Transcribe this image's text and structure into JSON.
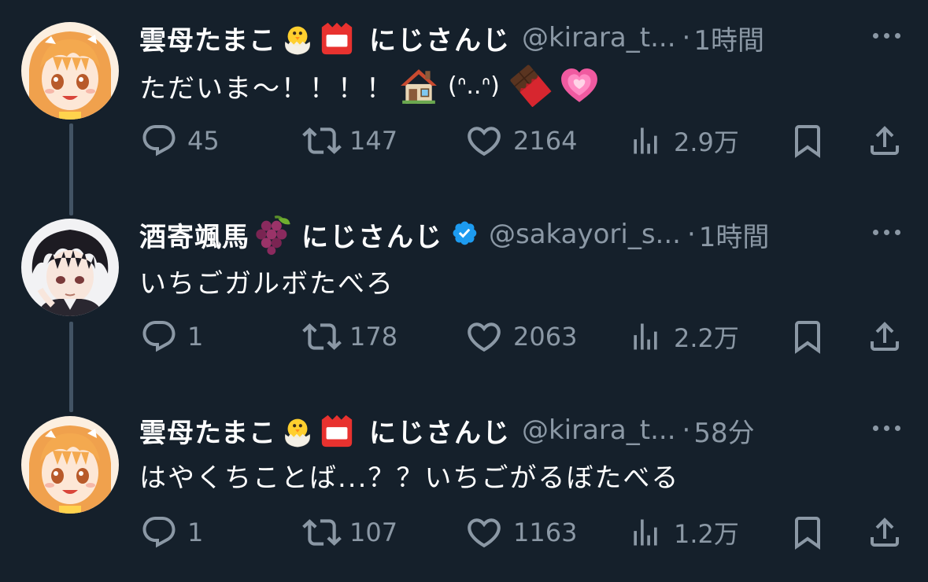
{
  "tweets": [
    {
      "display_name": "雲母たまこ",
      "org": "にじさんじ",
      "handle": "@kirara_t...",
      "separator": "·",
      "time": "1時間",
      "text": "ただいま〜！！！！",
      "emote": "(ᐢ..ᐢ)",
      "avatar_icon": "orange-hair-girl-avatar",
      "name_emojis": [
        "hatching-chick-icon",
        "name-badge-icon"
      ],
      "text_emojis": [
        "house-icon",
        "chocolate-bar-icon",
        "growing-heart-icon"
      ],
      "stats": {
        "replies": "45",
        "retweets": "147",
        "likes": "2164",
        "views": "2.9万"
      }
    },
    {
      "display_name": "酒寄颯馬",
      "org": "にじさんじ",
      "handle": "@sakayori_s...",
      "separator": "·",
      "time": "1時間",
      "text": "いちごガルボたべろ",
      "avatar_icon": "dark-hair-boy-avatar",
      "name_emojis": [
        "grapes-icon"
      ],
      "verified": true,
      "stats": {
        "replies": "1",
        "retweets": "178",
        "likes": "2063",
        "views": "2.2万"
      }
    },
    {
      "display_name": "雲母たまこ",
      "org": "にじさんじ",
      "handle": "@kirara_t...",
      "separator": "·",
      "time": "58分",
      "text": "はやくちことば...？？いちごがるぼたべる",
      "avatar_icon": "orange-hair-girl-avatar",
      "name_emojis": [
        "hatching-chick-icon",
        "name-badge-icon"
      ],
      "stats": {
        "replies": "1",
        "retweets": "107",
        "likes": "1163",
        "views": "1.2万"
      }
    }
  ],
  "colors": {
    "background": "#15202b",
    "muted": "#8b98a5",
    "thread_line": "#425364",
    "verified": "#1d9bf0"
  }
}
